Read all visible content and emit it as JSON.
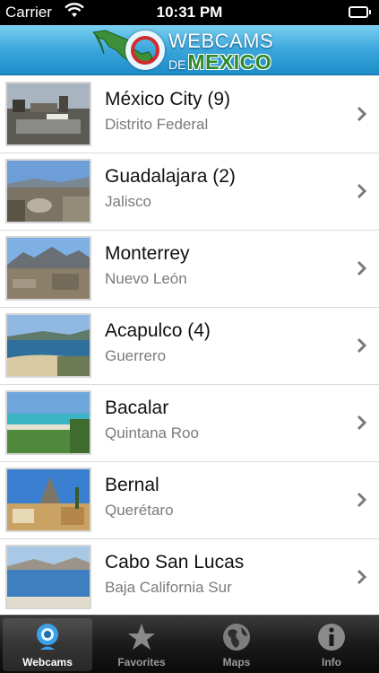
{
  "status_bar": {
    "carrier": "Carrier",
    "time": "10:31 PM"
  },
  "header": {
    "logo_line1": "WEBCAMS",
    "logo_line2_prefix": "DE",
    "logo_line2_main": "MEXICO"
  },
  "webcams": [
    {
      "city": "México City (9)",
      "state": "Distrito Federal"
    },
    {
      "city": "Guadalajara (2)",
      "state": "Jalisco"
    },
    {
      "city": "Monterrey",
      "state": "Nuevo León"
    },
    {
      "city": "Acapulco (4)",
      "state": "Guerrero"
    },
    {
      "city": "Bacalar",
      "state": "Quintana Roo"
    },
    {
      "city": "Bernal",
      "state": "Querétaro"
    },
    {
      "city": "Cabo San Lucas",
      "state": "Baja California Sur"
    }
  ],
  "tabs": [
    {
      "label": "Webcams",
      "icon": "webcam-icon",
      "active": true
    },
    {
      "label": "Favorites",
      "icon": "star-icon",
      "active": false
    },
    {
      "label": "Maps",
      "icon": "globe-icon",
      "active": false
    },
    {
      "label": "Info",
      "icon": "info-icon",
      "active": false
    }
  ],
  "colors": {
    "header_blue": "#3aa6dc",
    "logo_green": "#2f8a2c",
    "tab_active_blue": "#3aa0e8"
  }
}
